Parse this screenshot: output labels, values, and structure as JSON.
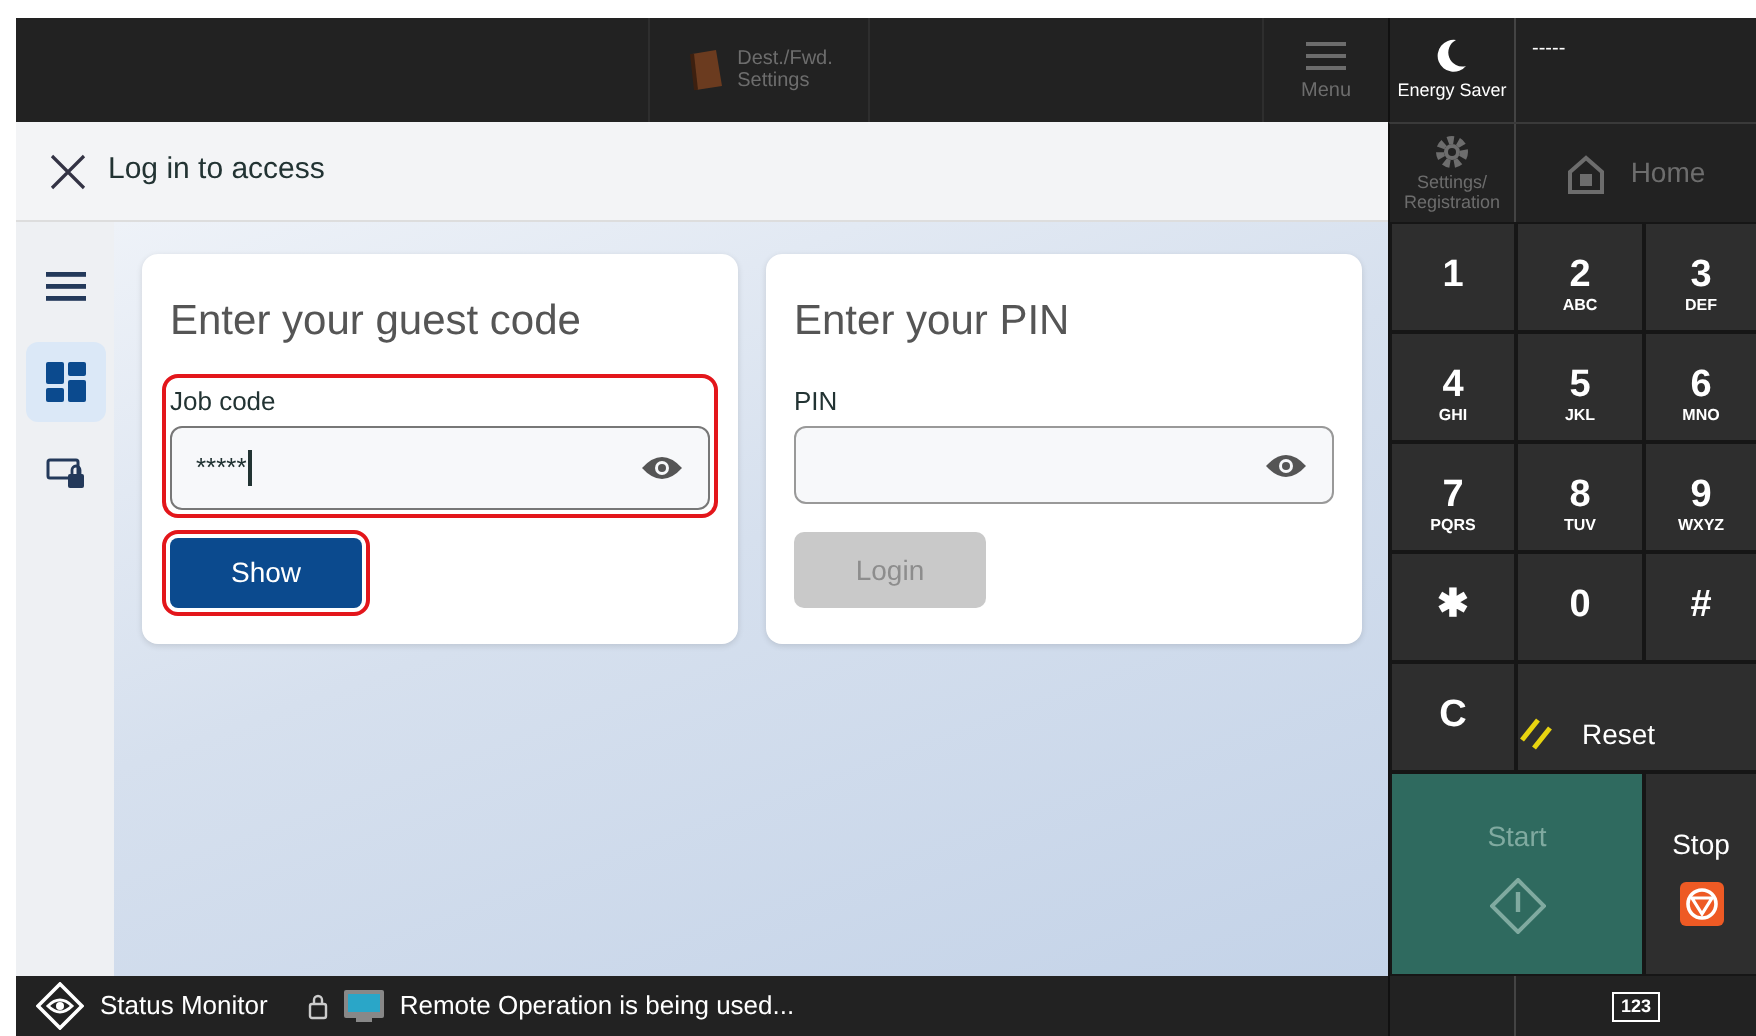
{
  "top_bar": {
    "dest_button": {
      "label_lines": [
        "Dest./Fwd.",
        "Settings"
      ],
      "disabled": true
    },
    "menu_button": {
      "label": "Menu",
      "disabled": true
    },
    "energy_saver": {
      "label": "Energy Saver"
    },
    "status_text": "-----"
  },
  "header": {
    "title": "Log in to access"
  },
  "side_panel": {
    "settings_button": {
      "label_lines": [
        "Settings/",
        "Registration"
      ],
      "disabled": true
    },
    "home_button": {
      "label": "Home",
      "disabled": true
    }
  },
  "sidebar": {
    "items": [
      {
        "kind": "menu",
        "selected": false
      },
      {
        "kind": "dashboard",
        "selected": true
      },
      {
        "kind": "card-lock",
        "selected": false
      }
    ]
  },
  "cards": [
    {
      "title": "Enter your guest code",
      "field": {
        "label": "Job code",
        "value": "*****",
        "focused": true,
        "highlighted": true
      },
      "button": {
        "label": "Show",
        "disabled": false,
        "highlighted": true
      }
    },
    {
      "title": "Enter your PIN",
      "field": {
        "label": "PIN",
        "focused": false,
        "highlighted": false
      },
      "button": {
        "label": "Login",
        "disabled": true,
        "highlighted": false
      }
    }
  ],
  "keypad": {
    "keys": [
      {
        "kind": "key",
        "main": "1"
      },
      {
        "kind": "key",
        "main": "2",
        "sub": "ABC"
      },
      {
        "kind": "key",
        "main": "3",
        "sub": "DEF"
      },
      {
        "kind": "key",
        "main": "4",
        "sub": "GHI"
      },
      {
        "kind": "key",
        "main": "5",
        "sub": "JKL"
      },
      {
        "kind": "key",
        "main": "6",
        "sub": "MNO"
      },
      {
        "kind": "key",
        "main": "7",
        "sub": "PQRS"
      },
      {
        "kind": "key",
        "main": "8",
        "sub": "TUV"
      },
      {
        "kind": "key",
        "main": "9",
        "sub": "WXYZ"
      },
      {
        "kind": "key",
        "main": "✱"
      },
      {
        "kind": "key",
        "main": "0"
      },
      {
        "kind": "key",
        "main": "#"
      },
      {
        "kind": "key",
        "main": "C"
      },
      {
        "kind": "reset",
        "main": "Reset"
      }
    ],
    "start": {
      "label": "Start",
      "disabled": true
    },
    "stop": {
      "label": "Stop",
      "disabled": false
    }
  },
  "status_bar": {
    "monitor_label": "Status Monitor",
    "message": "Remote Operation is being used...",
    "keyboard_label": "123"
  }
}
